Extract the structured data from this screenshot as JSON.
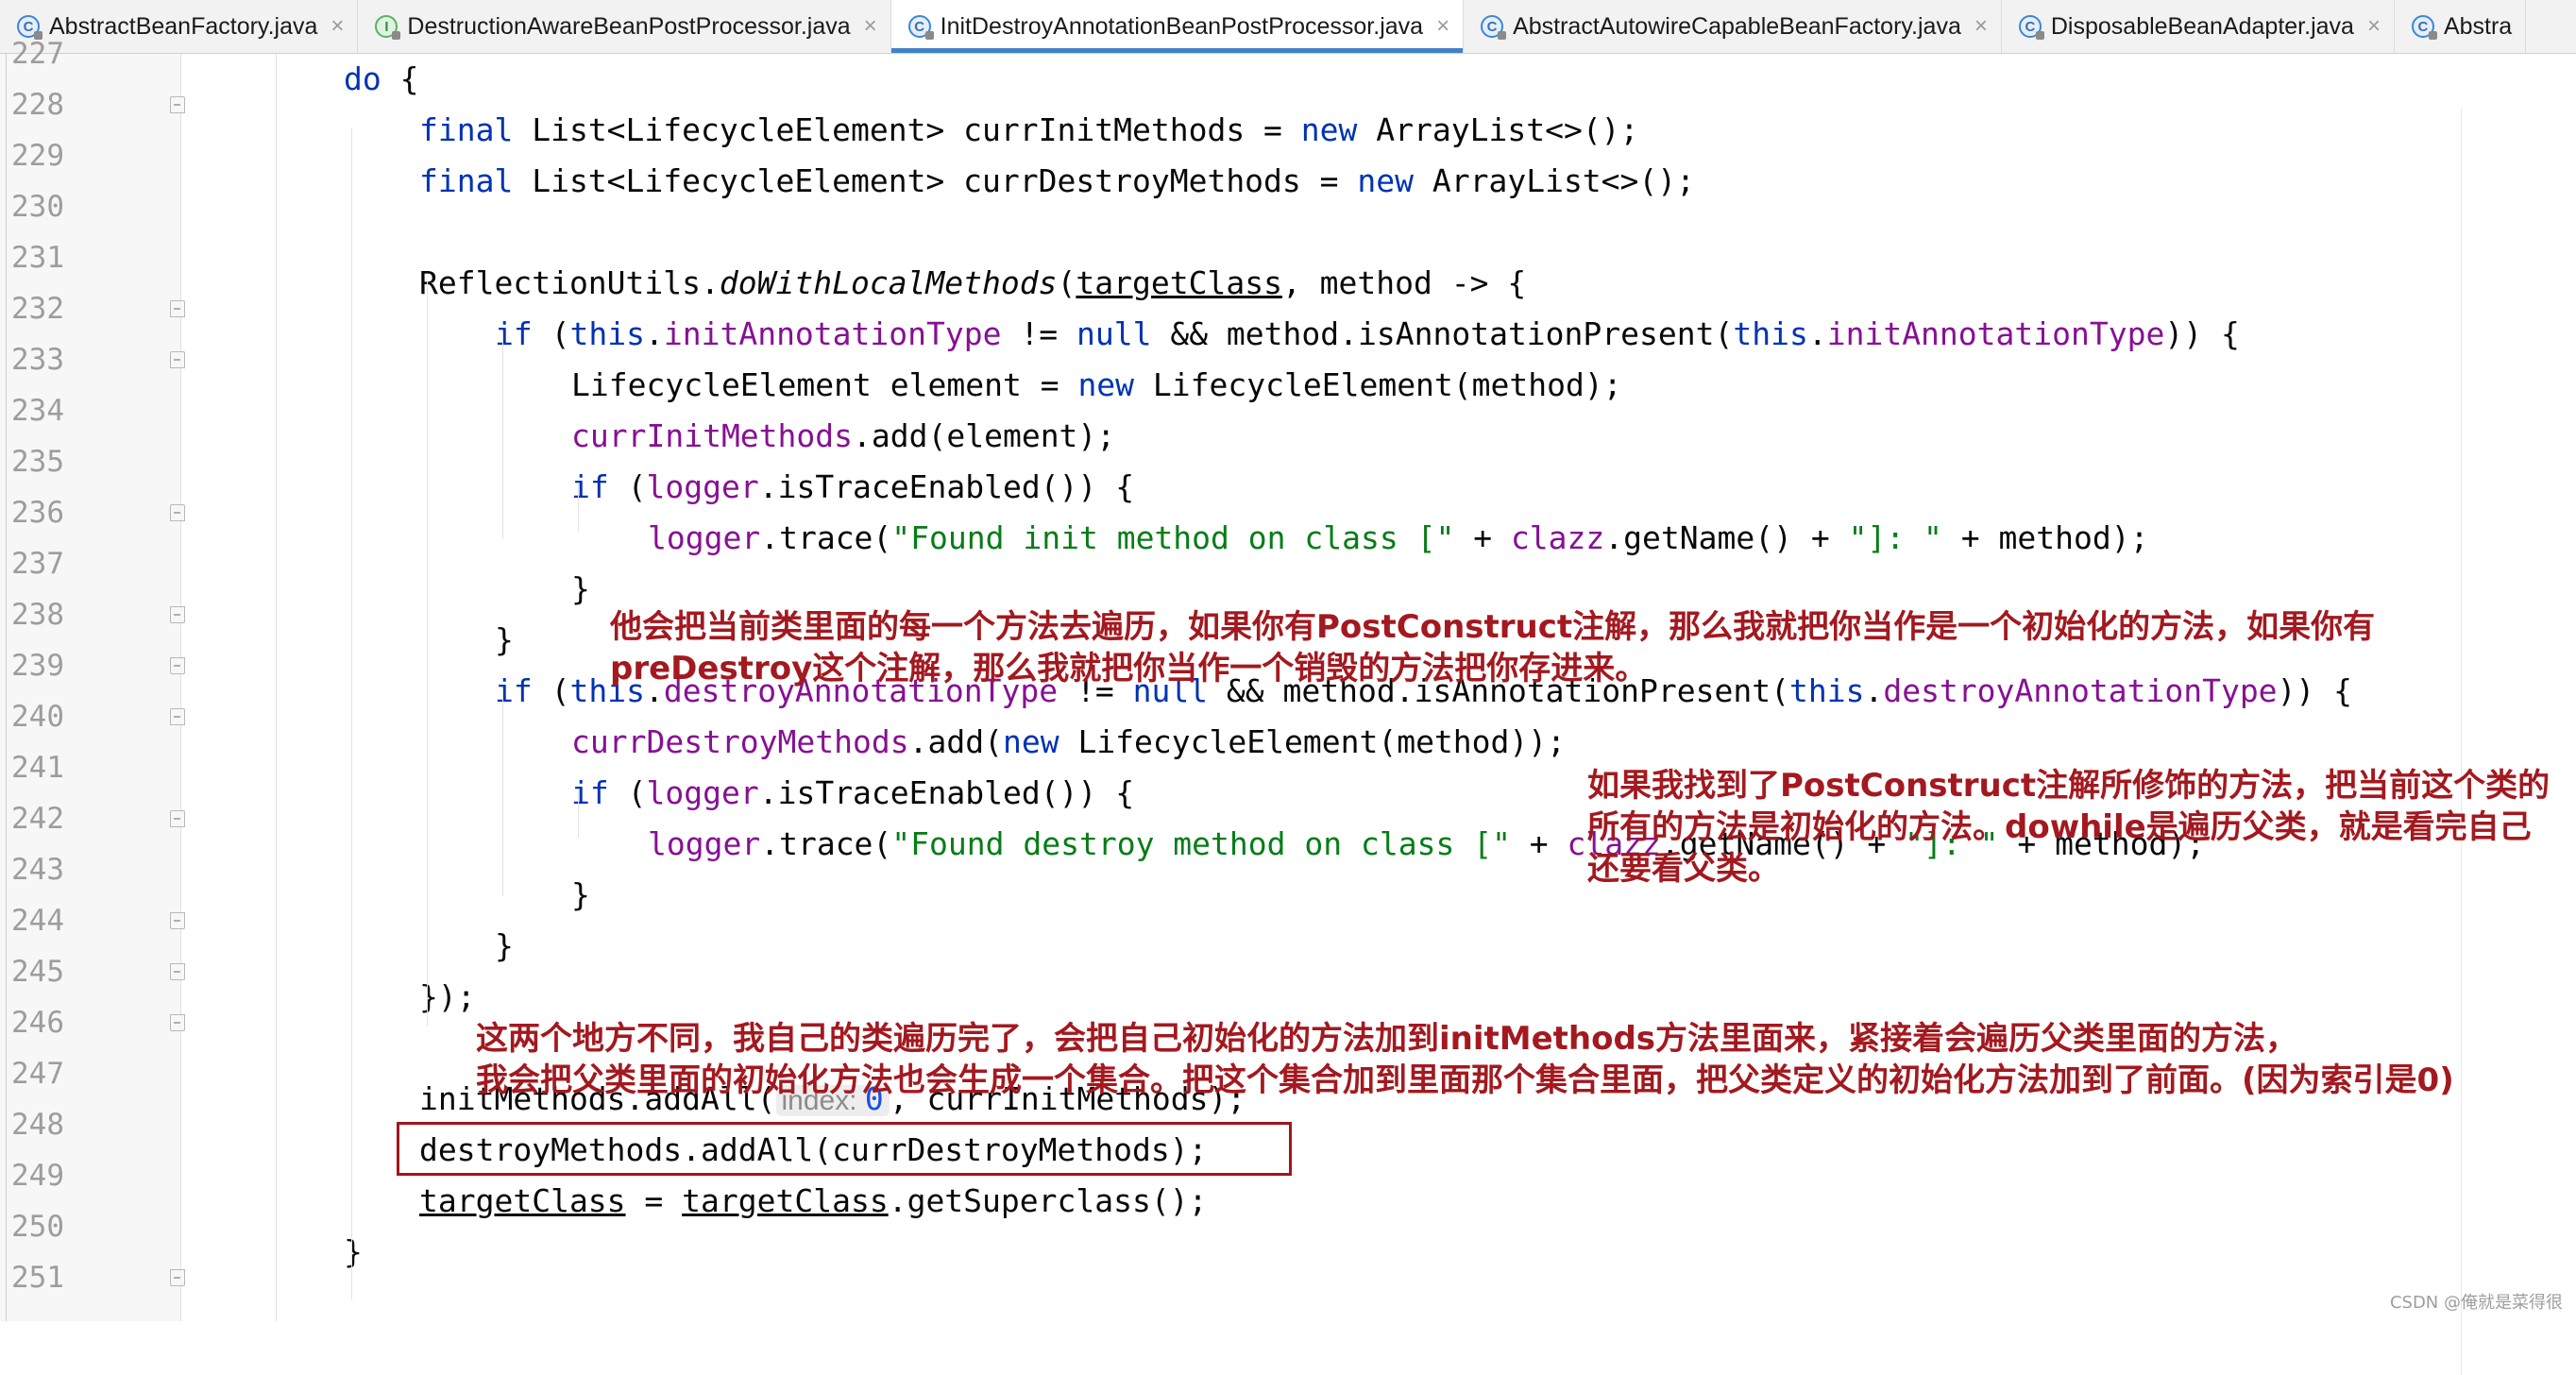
{
  "tabs": [
    {
      "label": "AbstractBeanFactory.java",
      "icon": "class-icon",
      "icon_letter": "C",
      "active": false,
      "closable": true
    },
    {
      "label": "DestructionAwareBeanPostProcessor.java",
      "icon": "interface-icon",
      "icon_letter": "I",
      "active": false,
      "closable": true
    },
    {
      "label": "InitDestroyAnnotationBeanPostProcessor.java",
      "icon": "class-icon",
      "icon_letter": "C",
      "active": true,
      "closable": true
    },
    {
      "label": "AbstractAutowireCapableBeanFactory.java",
      "icon": "class-icon",
      "icon_letter": "C",
      "active": false,
      "closable": true
    },
    {
      "label": "DisposableBeanAdapter.java",
      "icon": "class-icon",
      "icon_letter": "C",
      "active": false,
      "closable": true
    },
    {
      "label": "Abstra",
      "icon": "class-icon",
      "icon_letter": "C",
      "active": false,
      "closable": false
    }
  ],
  "close_glyph": "×",
  "line_numbers": [
    "227",
    "228",
    "229",
    "230",
    "231",
    "232",
    "233",
    "234",
    "235",
    "236",
    "237",
    "238",
    "239",
    "240",
    "241",
    "242",
    "243",
    "244",
    "245",
    "246",
    "247",
    "248",
    "249",
    "250",
    "251"
  ],
  "code": {
    "l228": {
      "kw": "do",
      "rest": " {"
    },
    "l229": {
      "kw1": "final",
      "a": " List<LifecycleElement> currInitMethods = ",
      "kw2": "new",
      "b": " ArrayList<>();"
    },
    "l230": {
      "kw1": "final",
      "a": " List<LifecycleElement> currDestroyMethods = ",
      "kw2": "new",
      "b": " ArrayList<>();"
    },
    "l232": {
      "a": "ReflectionUtils.",
      "method": "doWithLocalMethods",
      "b": "(",
      "arg": "targetClass",
      "c": ", method -> {"
    },
    "l233": {
      "kw1": "if",
      "a": " (",
      "kw2": "this",
      "b": ".",
      "fld1": "initAnnotationType",
      "c": " != ",
      "kw3": "null",
      "d": " && method.isAnnotationPresent(",
      "kw4": "this",
      "e": ".",
      "fld2": "initAnnotationType",
      "f": ")) {"
    },
    "l234": {
      "a": "LifecycleElement element = ",
      "kw": "new",
      "b": " LifecycleElement(method);"
    },
    "l235": {
      "fld": "currInitMethods",
      "a": ".add(element);"
    },
    "l236": {
      "kw": "if",
      "a": " (",
      "fld": "logger",
      "b": ".isTraceEnabled()) {"
    },
    "l237": {
      "fld1": "logger",
      "a": ".trace(",
      "str1": "\"Found init method on class [\"",
      "b": " + ",
      "fld2": "clazz",
      "c": ".getName() + ",
      "str2": "\"]: \"",
      "d": " + method);"
    },
    "l238": {
      "a": "}"
    },
    "l239": {
      "a": "}"
    },
    "l240": {
      "kw1": "if",
      "a": " (",
      "kw2": "this",
      "b": ".",
      "fld1": "destroyAnnotationType",
      "c": " != ",
      "kw3": "null",
      "d": " && method.isAnnotationPresent(",
      "kw4": "this",
      "e": ".",
      "fld2": "destroyAnnotationType",
      "f": ")) {"
    },
    "l241": {
      "fld": "currDestroyMethods",
      "a": ".add(",
      "kw": "new",
      "b": " LifecycleElement(method));"
    },
    "l242": {
      "kw": "if",
      "a": " (",
      "fld": "logger",
      "b": ".isTraceEnabled()) {"
    },
    "l243": {
      "fld1": "logger",
      "a": ".trace(",
      "str1": "\"Found destroy method on class [\"",
      "b": " + ",
      "fld2": "clazz",
      "c": ".getName() + ",
      "str2": "\"]: \"",
      "d": " + method);"
    },
    "l244": {
      "a": "}"
    },
    "l245": {
      "a": "}"
    },
    "l246": {
      "a": "});"
    },
    "l248": {
      "a": "initMethods.addAll(",
      "hint_label": "index:",
      "hint_value": "0",
      "b": ", currInitMethods);"
    },
    "l249": {
      "a": "destroyMethods.addAll(currDestroyMethods);"
    },
    "l250": {
      "var1": "targetClass",
      "a": " = ",
      "var2": "targetClass",
      "b": ".getSuperclass();"
    },
    "l251": {
      "a": "}"
    }
  },
  "annotations": {
    "note1_line1": "他会把当前类里面的每一个方法去遍历，如果你有PostConstruct注解，那么我就把你当作是一个初始化的方法，如果你有",
    "note1_line2": "preDestroy这个注解，那么我就把你当作一个销毁的方法把你存进来。",
    "note2_line1": "如果我找到了PostConstruct注解所修饰的方法，把当前这个类的",
    "note2_line2": "所有的方法是初始化的方法。dowhile是遍历父类，就是看完自己",
    "note2_line3": "还要看父类。",
    "note3_line1": "这两个地方不同，我自己的类遍历完了，会把自己初始化的方法加到initMethods方法里面来，紧接着会遍历父类里面的方法，",
    "note3_line2": "我会把父类里面的初始化方法也会生成一个集合。把这个集合加到里面那个集合里面，把父类定义的初始化方法加到了前面。(因为索引是0)"
  },
  "watermark": "CSDN @俺就是菜得很",
  "colors": {
    "keyword": "#0033b3",
    "field": "#871094",
    "string": "#067d17",
    "number": "#1750eb",
    "annotation_red": "#a3191f",
    "active_tab_underline": "#4083c9"
  }
}
